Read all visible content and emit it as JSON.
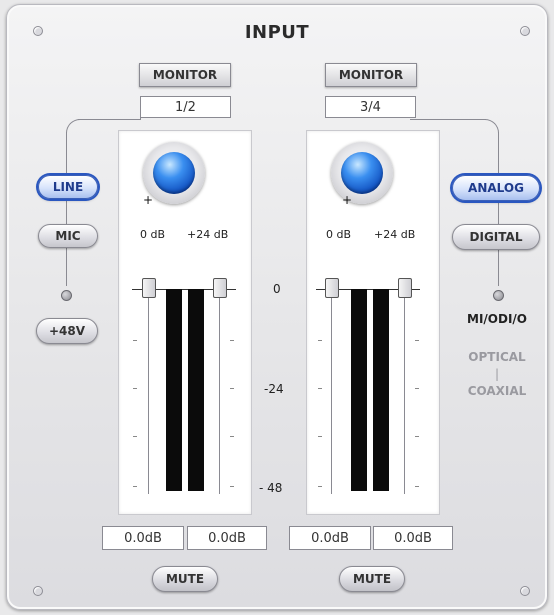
{
  "title": "INPUT",
  "left_group": {
    "monitor_label": "MONITOR",
    "channel": "1/2",
    "source_buttons": [
      {
        "label": "LINE",
        "active": true
      },
      {
        "label": "MIC",
        "active": false
      }
    ],
    "phantom_label": "+48V",
    "knob_min": "0 dB",
    "knob_max": "+24 dB",
    "readouts": [
      "0.0dB",
      "0.0dB"
    ],
    "mute_label": "MUTE"
  },
  "right_group": {
    "monitor_label": "MONITOR",
    "channel": "3/4",
    "source_buttons": [
      {
        "label": "ANALOG",
        "active": true
      },
      {
        "label": "DIGITAL",
        "active": false
      }
    ],
    "digital_format": "MI/ODI/O",
    "digital_options": [
      "OPTICAL",
      "|",
      "COAXIAL"
    ],
    "knob_min": "0 dB",
    "knob_max": "+24 dB",
    "readouts": [
      "0.0dB",
      "0.0dB"
    ],
    "mute_label": "MUTE"
  },
  "scale": [
    "0",
    "-24",
    "- 48"
  ],
  "colors": {
    "active_blue": "#2a57c0",
    "knob_blue": "#1e6fe0",
    "meter_black": "#0b0b0b",
    "disabled_text": "#9a9aa0"
  }
}
